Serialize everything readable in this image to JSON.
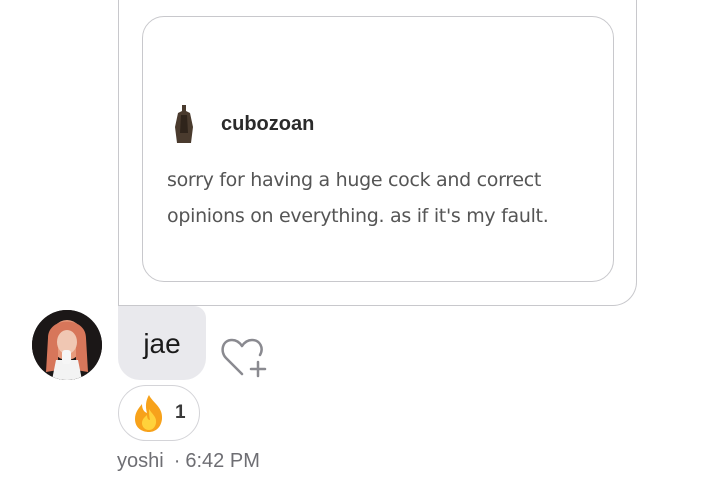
{
  "quoted_post": {
    "username": "cubozoan",
    "text": "sorry for having a huge cock and correct opinions on everything. as if it's my fault."
  },
  "message": {
    "sender_name": "jae",
    "reaction": {
      "emoji": "🔥",
      "icon": "fire-icon",
      "count": "1"
    },
    "reacted_by": "yoshi",
    "separator": "·",
    "timestamp": "6:42 PM"
  },
  "colors": {
    "bubble_bg": "#e9e9ed",
    "border": "#c8c8cc",
    "meta_text": "#6e6e73"
  }
}
